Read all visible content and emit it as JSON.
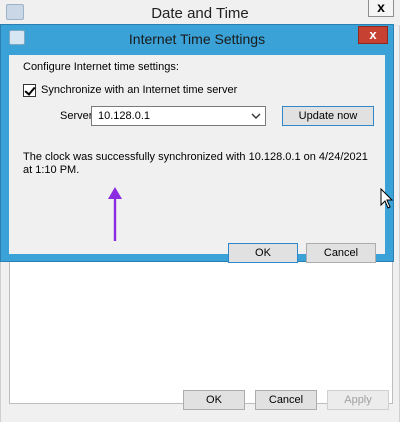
{
  "parent": {
    "title": "Date and Time",
    "close_glyph": "x",
    "buttons": {
      "ok": "OK",
      "cancel": "Cancel",
      "apply": "Apply"
    }
  },
  "dialog": {
    "title": "Internet Time Settings",
    "close_glyph": "x",
    "intro": "Configure Internet time settings:",
    "sync_checkbox_label": "Synchronize with an Internet time server",
    "sync_checked": true,
    "server_label": "Server:",
    "server_value": "10.128.0.1",
    "update_button": "Update now",
    "status_message": "The clock was successfully synchronized with 10.128.0.1 on 4/24/2021 at 1:10 PM.",
    "ok_button": "OK",
    "cancel_button": "Cancel"
  },
  "icons": {
    "parent_app": "clock-icon",
    "dialog_app": "clock-icon",
    "dropdown": "chevron-down-icon",
    "annotation": "arrow-up-icon",
    "cursor": "mouse-pointer-icon"
  },
  "colors": {
    "dialog_frame": "#3aa2d6",
    "close_button": "#c74133",
    "annotation_arrow": "#8a2be2",
    "focus_border": "#2f86c9"
  }
}
